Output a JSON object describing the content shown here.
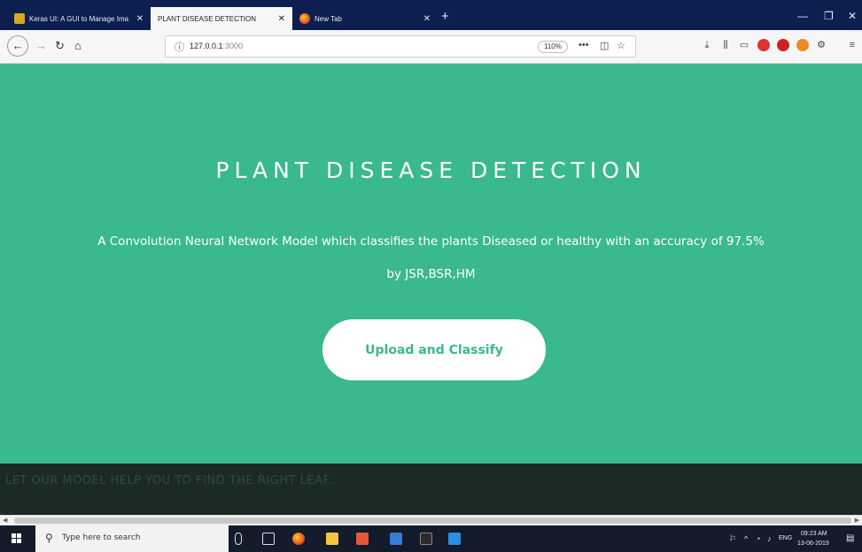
{
  "browser": {
    "tabs": [
      {
        "title": "Keras UI: A GUI to Manage Ima",
        "active": false
      },
      {
        "title": "PLANT DISEASE DETECTION",
        "active": true
      },
      {
        "title": "New Tab",
        "active": false
      }
    ],
    "address": {
      "host": "127.0.0.1",
      "port": ":3000",
      "zoom": "110%"
    }
  },
  "page": {
    "title": "PLANT DISEASE DETECTION",
    "description": "A Convolution Neural Network Model which classifies the plants Diseased or healthy with an accuracy of 97.5%",
    "authors": "by JSR,BSR,HM",
    "upload_button": "Upload and Classify",
    "footer_tagline": "LET OUR MODEL HELP YOU TO FIND THE RIGHT LEAF.."
  },
  "colors": {
    "accent": "#3ab88e",
    "footer": "#1c2a24",
    "tabbar": "#0c1f4f"
  },
  "taskbar": {
    "search_placeholder": "Type here to search",
    "time": "09:23 AM",
    "date": "13-06-2019",
    "language": "ENG"
  }
}
